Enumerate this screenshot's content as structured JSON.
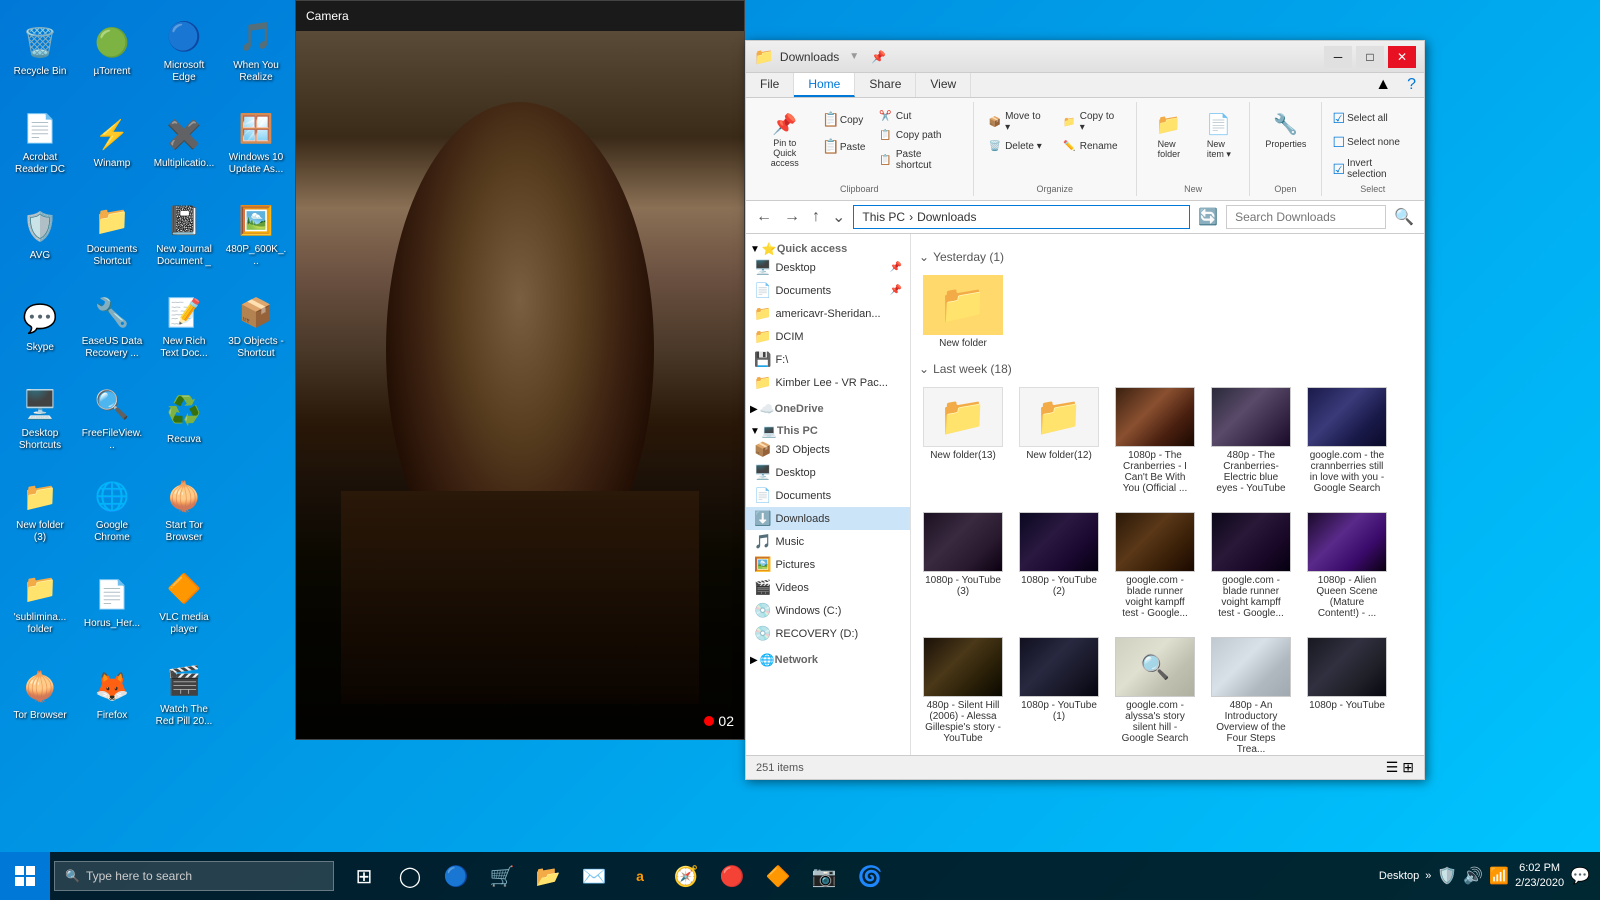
{
  "desktop": {
    "icons": [
      {
        "id": "recycle-bin",
        "label": "Recycle Bin",
        "icon": "🗑️"
      },
      {
        "id": "utorrent",
        "label": "µTorrent",
        "icon": "🟢"
      },
      {
        "id": "microsoft-edge",
        "label": "Microsoft Edge",
        "icon": "🔵"
      },
      {
        "id": "when-you-realize",
        "label": "When You Realize",
        "icon": "🎵"
      },
      {
        "id": "acrobat-reader",
        "label": "Acrobat Reader DC",
        "icon": "📄"
      },
      {
        "id": "winamp",
        "label": "Winamp",
        "icon": "⚡"
      },
      {
        "id": "multiplication",
        "label": "Multiplicatio...",
        "icon": "✖️"
      },
      {
        "id": "windows-10-update",
        "label": "Windows 10 Update As...",
        "icon": "🪟"
      },
      {
        "id": "avg",
        "label": "AVG",
        "icon": "🛡️"
      },
      {
        "id": "documents-shortcut",
        "label": "Documents Shortcut",
        "icon": "📁"
      },
      {
        "id": "new-journal-doc",
        "label": "New Journal Document _",
        "icon": "📓"
      },
      {
        "id": "480p-600k",
        "label": "480P_600K_...",
        "icon": "🖼️"
      },
      {
        "id": "skype",
        "label": "Skype",
        "icon": "💬"
      },
      {
        "id": "easeus",
        "label": "EaseUS Data Recovery ...",
        "icon": "🔧"
      },
      {
        "id": "new-rich-text",
        "label": "New Rich Text Doc...",
        "icon": "📝"
      },
      {
        "id": "3d-objects",
        "label": "3D Objects - Shortcut",
        "icon": "📦"
      },
      {
        "id": "desktop-shortcuts",
        "label": "Desktop Shortcuts",
        "icon": "🖥️"
      },
      {
        "id": "freefileview",
        "label": "FreeFileView...",
        "icon": "🔍"
      },
      {
        "id": "recuva",
        "label": "Recuva",
        "icon": "♻️"
      },
      {
        "id": "new-folder-3",
        "label": "New folder (3)",
        "icon": "📁"
      },
      {
        "id": "google-chrome",
        "label": "Google Chrome",
        "icon": "🌐"
      },
      {
        "id": "start-tor-browser",
        "label": "Start Tor Browser",
        "icon": "🧅"
      },
      {
        "id": "sublimina-folder",
        "label": "'sublimina... folder",
        "icon": "📁"
      },
      {
        "id": "horus-her",
        "label": "Horus_Her...",
        "icon": "📄"
      },
      {
        "id": "vlc",
        "label": "VLC media player",
        "icon": "🔶"
      },
      {
        "id": "tor-browser",
        "label": "Tor Browser",
        "icon": "🧅"
      },
      {
        "id": "firefox",
        "label": "Firefox",
        "icon": "🦊"
      },
      {
        "id": "watch-red-pill",
        "label": "Watch The Red Pill 20...",
        "icon": "🎬"
      }
    ]
  },
  "camera": {
    "title": "Camera",
    "rec_text": "02"
  },
  "explorer": {
    "title": "Downloads",
    "address": "This PC > Downloads",
    "search_placeholder": "Search Downloads",
    "status": "251 items",
    "ribbon": {
      "tabs": [
        "File",
        "Home",
        "Share",
        "View"
      ],
      "active_tab": "Home",
      "groups": {
        "clipboard": {
          "label": "Clipboard",
          "buttons": [
            {
              "label": "Pin to Quick\naccess",
              "icon": "📌"
            },
            {
              "label": "Copy",
              "icon": "📋"
            },
            {
              "label": "Paste",
              "icon": "📋"
            },
            {
              "label": "Cut",
              "icon": "✂️"
            },
            {
              "label": "Copy path",
              "icon": "📋"
            },
            {
              "label": "Paste shortcut",
              "icon": "📋"
            }
          ]
        },
        "organize": {
          "label": "Organize",
          "buttons": [
            {
              "label": "Move to",
              "icon": "📦"
            },
            {
              "label": "Delete",
              "icon": "🗑️"
            },
            {
              "label": "Copy to",
              "icon": "📁"
            },
            {
              "label": "Rename",
              "icon": "✏️"
            }
          ]
        },
        "new": {
          "label": "New",
          "buttons": [
            {
              "label": "New folder",
              "icon": "📁"
            }
          ]
        },
        "open": {
          "label": "Open"
        },
        "select": {
          "label": "Select",
          "buttons": [
            {
              "label": "Select all"
            },
            {
              "label": "Select none"
            },
            {
              "label": "Invert selection"
            }
          ]
        }
      }
    },
    "sidebar": {
      "quick_access": {
        "label": "Quick access",
        "items": [
          {
            "label": "Desktop",
            "icon": "🖥️",
            "pinned": true
          },
          {
            "label": "Documents",
            "icon": "📄",
            "pinned": true
          },
          {
            "label": "americavr-Sheridan...",
            "icon": "📁"
          },
          {
            "label": "DCIM",
            "icon": "📁"
          },
          {
            "label": "F:\\",
            "icon": "💾"
          },
          {
            "label": "Kimber Lee - VR Pac...",
            "icon": "📁"
          }
        ]
      },
      "onedrive": {
        "label": "OneDrive",
        "icon": "☁️"
      },
      "this_pc": {
        "label": "This PC",
        "items": [
          {
            "label": "3D Objects",
            "icon": "📦"
          },
          {
            "label": "Desktop",
            "icon": "🖥️"
          },
          {
            "label": "Documents",
            "icon": "📄"
          },
          {
            "label": "Downloads",
            "icon": "⬇️",
            "active": true
          },
          {
            "label": "Music",
            "icon": "🎵"
          },
          {
            "label": "Pictures",
            "icon": "🖼️"
          },
          {
            "label": "Videos",
            "icon": "🎬"
          },
          {
            "label": "Windows (C:)",
            "icon": "💿"
          },
          {
            "label": "RECOVERY (D:)",
            "icon": "💿"
          }
        ]
      },
      "network": {
        "label": "Network",
        "icon": "🌐"
      }
    },
    "sections": [
      {
        "label": "Yesterday (1)",
        "items": [
          {
            "name": "New folder",
            "type": "folder",
            "thumb_class": "folder"
          }
        ]
      },
      {
        "label": "Last week (18)",
        "items": [
          {
            "name": "New folder(13)",
            "type": "folder",
            "thumb_class": "folder"
          },
          {
            "name": "New folder(12)",
            "type": "folder",
            "thumb_class": "folder"
          },
          {
            "name": "1080p - The Cranberries - I Can't Be With You (Official ...",
            "type": "video",
            "thumb_class": "thumb-dark1"
          },
          {
            "name": "480p - The Cranberries- Electric blue eyes - YouTube",
            "type": "video",
            "thumb_class": "thumb-portrait"
          },
          {
            "name": "google.com - the crannberries still in love with you - Google Search",
            "type": "video",
            "thumb_class": "thumb-blue"
          },
          {
            "name": "1080p - YouTube (3)",
            "type": "video",
            "thumb_class": "thumb-dark2"
          },
          {
            "name": "1080p - YouTube (2)",
            "type": "video",
            "thumb_class": "thumb-dark3"
          },
          {
            "name": "google.com - blade runner voight kampff test - Google...",
            "type": "video",
            "thumb_class": "thumb-dark1"
          },
          {
            "name": "google.com - blade runner voight kampff test - Google...",
            "type": "video",
            "thumb_class": "thumb-dark2"
          },
          {
            "name": "1080p - Alien Queen Scene (Mature Content!) - ...",
            "type": "video",
            "thumb_class": "thumb-blue"
          },
          {
            "name": "480p - Silent Hill (2006) - Alessa Gillespie's story - YouTube",
            "type": "video",
            "thumb_class": "thumb-dark1"
          },
          {
            "name": "1080p - YouTube (1)",
            "type": "video",
            "thumb_class": "thumb-dark3"
          },
          {
            "name": "google.com - alyssa's story silent hill - Google Search",
            "type": "video",
            "thumb_class": "thumb-white"
          },
          {
            "name": "480p - An Introductory Overview of the Four Steps Trea...",
            "type": "video",
            "thumb_class": "thumb-portrait"
          },
          {
            "name": "1080p - YouTube",
            "type": "video",
            "thumb_class": "thumb-dark2"
          }
        ]
      }
    ]
  },
  "taskbar": {
    "search_placeholder": "Type here to search",
    "icons": [
      "🪟",
      "🔍",
      "📋",
      "🔵",
      "🛒",
      "📂",
      "✉️",
      "🅰",
      "🧭",
      "🔶",
      "📷",
      "🌀"
    ],
    "time": "6:02 PM",
    "date": "2/23/2020",
    "desktop_label": "Desktop"
  }
}
